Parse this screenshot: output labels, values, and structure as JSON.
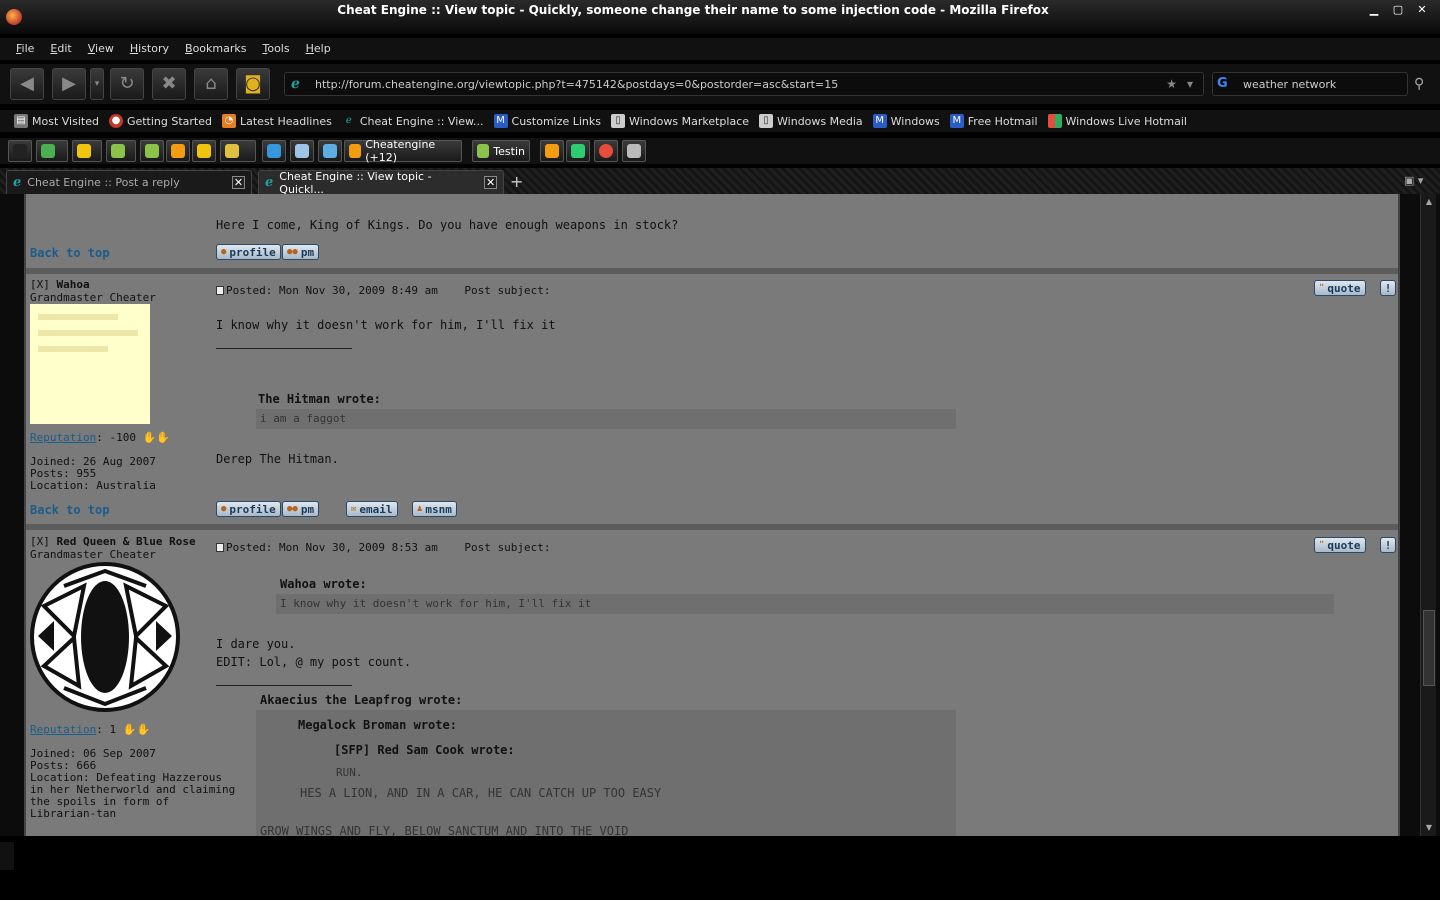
{
  "window": {
    "title": "Cheat Engine :: View topic - Quickly, someone change their name to some injection code - Mozilla Firefox"
  },
  "menu": [
    "File",
    "Edit",
    "View",
    "History",
    "Bookmarks",
    "Tools",
    "Help"
  ],
  "nav": {
    "url": "http://forum.cheatengine.org/viewtopic.php?t=475142&postdays=0&postorder=asc&start=15",
    "search_query": "weather network"
  },
  "bookmarks": [
    "Most Visited",
    "Getting Started",
    "Latest Headlines",
    "Cheat Engine :: View...",
    "Customize Links",
    "Windows Marketplace",
    "Windows Media",
    "Windows",
    "Free Hotmail",
    "Windows Live Hotmail"
  ],
  "extensions": {
    "cheatengine": "Cheatengine (+12)",
    "testin": "Testin"
  },
  "tabs": [
    {
      "label": "Cheat Engine :: Post a reply",
      "active": false
    },
    {
      "label": "Cheat Engine :: View topic - Quickl...",
      "active": true
    }
  ],
  "common": {
    "back_to_top": "Back to top",
    "profile": "profile",
    "pm": "pm",
    "email": "email",
    "msnm": "msnm",
    "quote": "quote",
    "report": "!",
    "reputation": "Reputation",
    "post_subject": "Post subject:",
    "wrote": "wrote:"
  },
  "post0": {
    "body": "Here I come, King of Kings. Do you have enough weapons in stock?"
  },
  "post1": {
    "prefix": "[X]",
    "author": "Wahoa",
    "rank": "Grandmaster Cheater",
    "reputation": ": -100",
    "joined": "Joined: 26 Aug 2007",
    "posts": "Posts: 955",
    "location": "Location: Australia",
    "posted": "Posted: Mon Nov 30, 2009 8:49 am",
    "body1": "I know why it doesn't work for him, I'll fix it",
    "quote_author": "The Hitman wrote:",
    "quote_text": "i am a faggot",
    "body2": "Derep The Hitman."
  },
  "post2": {
    "prefix": "[X]",
    "author": "Red Queen & Blue Rose",
    "rank": "Grandmaster Cheater",
    "reputation": ": 1",
    "joined": "Joined: 06 Sep 2007",
    "posts": "Posts: 666",
    "location_lines": [
      "Location: Defeating Hazzerous",
      "in her Netherworld and claiming",
      "the spoils in form of",
      "Librarian-tan"
    ],
    "posted": "Posted: Mon Nov 30, 2009 8:53 am",
    "quote_author": "Wahoa wrote:",
    "quote_text": "I know why it doesn't work for him, I'll fix it",
    "body1": "I dare you.",
    "body2": "EDIT: Lol, @ my post count.",
    "sig_q1": "Akaecius the Leapfrog wrote:",
    "sig_q2": "Megalock Broman wrote:",
    "sig_q3": "[SFP] Red Sam Cook wrote:",
    "sig_q3_text": "RUN.",
    "sig_q2_text": "HES A LION, AND IN A CAR, HE CAN CATCH UP TOO EASY",
    "sig_q1_text": "GROW WINGS AND FLY, BELOW SANCTUM AND INTO THE VOID"
  }
}
